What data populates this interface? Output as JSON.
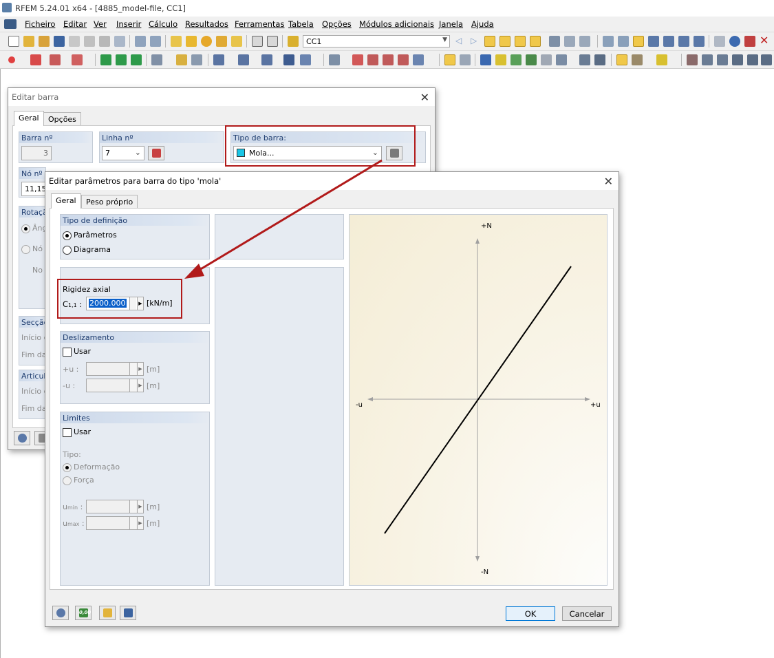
{
  "app": {
    "title": "RFEM 5.24.01 x64 - [4885_model-file, CC1]"
  },
  "menu": [
    "Ficheiro",
    "Editar",
    "Ver",
    "Inserir",
    "Cálculo",
    "Resultados",
    "Ferramentas",
    "Tabela",
    "Opções",
    "Módulos adicionais",
    "Janela",
    "Ajuda"
  ],
  "toolbar": {
    "load_case": "CC1"
  },
  "dlg1": {
    "title": "Editar barra",
    "tabs": [
      "Geral",
      "Opções"
    ],
    "member_no_label": "Barra nº",
    "member_no": "3",
    "line_no_label": "Linha nº",
    "line_no": "7",
    "member_type_label": "Tipo de barra:",
    "member_type": "Mola...",
    "node_label": "Nó nº",
    "node_value": "11,15",
    "rot_label": "Rotaçã",
    "ang_label": "Ângu",
    "node_opt": "Nó a",
    "no_label": "No p",
    "sec_label": "Secção",
    "start1": "Início d",
    "end1": "Fim da",
    "art_label": "Articula",
    "start2": "Início d",
    "end2": "Fim da"
  },
  "dlg2": {
    "title": "Editar parâmetros para barra do tipo 'mola'",
    "tabs": [
      "Geral",
      "Peso próprio"
    ],
    "def_type": {
      "title": "Tipo de definição",
      "opt1": "Parâmetros",
      "opt2": "Diagrama"
    },
    "axial": {
      "title": "Rigidez axial",
      "symbol": "C",
      "sub": "1,1",
      "colon": ":",
      "value": "2000.000",
      "unit": "[kN/m]"
    },
    "slip": {
      "title": "Deslizamento",
      "use": "Usar",
      "pu": "+u :",
      "mu": "-u :",
      "unit": "[m]"
    },
    "limits": {
      "title": "Limites",
      "use": "Usar",
      "type": "Tipo:",
      "opt1": "Deformação",
      "opt2": "Força",
      "umin_sym": "u",
      "umin_sub": "min",
      "umax_sym": "u",
      "umax_sub": "max",
      "colon": ":",
      "unit": "[m]"
    },
    "diagram": {
      "top": "+N",
      "bottom": "-N",
      "left": "-u",
      "right": "+u"
    },
    "ok": "OK",
    "cancel": "Cancelar",
    "calc_icon_text": "0,00"
  },
  "colors": {
    "highlight_red": "#b11a1a",
    "spring_cyan": "#19c6e6",
    "selection_blue": "#0a5fc9"
  }
}
